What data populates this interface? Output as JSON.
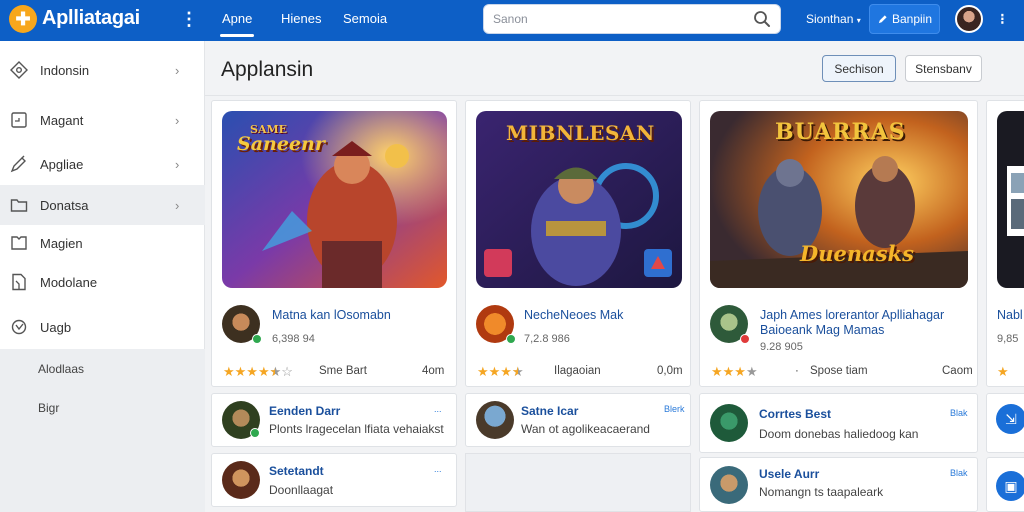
{
  "app": {
    "name": "Aplliatagai",
    "logo_glyph": "✚"
  },
  "topnav": {
    "tabs": [
      "Apne",
      "Hienes",
      "Semoia"
    ],
    "active_index": 0
  },
  "search": {
    "placeholder": "Sanon"
  },
  "toolbar": {
    "dropdown_label": "Sionthan",
    "button_label": "Banpiin"
  },
  "sidebar": {
    "items": [
      {
        "label": "Indonsin",
        "icon": "compass-icon",
        "chevron": true
      },
      {
        "label": "Magant",
        "icon": "file-icon",
        "chevron": true
      },
      {
        "label": "Apgliae",
        "icon": "tag-icon",
        "chevron": true
      },
      {
        "label": "Donatsa",
        "icon": "folder-icon",
        "chevron": true
      },
      {
        "label": "Magien",
        "icon": "bookmark-icon",
        "chevron": false
      },
      {
        "label": "Modolane",
        "icon": "document-icon",
        "chevron": false
      },
      {
        "label": "Uagb",
        "icon": "gear-icon",
        "chevron": false
      }
    ],
    "subitems": [
      "Alodlaas",
      "Bigr"
    ]
  },
  "page": {
    "title": "Applansin",
    "primary_button": "Sechison",
    "secondary_button": "Stensbanv"
  },
  "featured": [
    {
      "hero_title": "Saneenr",
      "hero_subtitle": "SAME",
      "name": "Matna kan lOsomabn",
      "size": "6,398 94",
      "rating": 4.5,
      "rating_label": "Sme Bart",
      "rating_value": "4om"
    },
    {
      "hero_title": "MIBNLESAN",
      "name": "NecheNeoes Mak",
      "size": "7,2.8 986",
      "rating": 3.5,
      "rating_label": "Ilagaoian",
      "rating_value": "0,0m"
    },
    {
      "hero_title": "BUARRAS",
      "hero_bottom": "Duenasks",
      "name": "Japh Ames lorerantor Aplliahagar Baioeank Mag Mamas",
      "size": "9.28 905",
      "rating": 4,
      "rating_label": "Spose tiam",
      "rating_value": "Caom"
    },
    {
      "name": "Nabl",
      "size": "9,85",
      "rating": 1
    }
  ],
  "list_items": [
    {
      "name": "Eenden Darr",
      "desc": "Plonts lragecelan lfiata vehaiakst",
      "meta": "..."
    },
    {
      "name": "Setetandt",
      "desc": "Doonllaagat",
      "meta": "..."
    },
    {
      "name": "Satne Icar",
      "desc": "Wan ot agolikeacaerand",
      "meta": "Blerk"
    },
    {
      "name": "Corrtes Best",
      "desc": "Doom donebas haliedoog kan",
      "meta": "Blak"
    },
    {
      "name": "Usele Aurr",
      "desc": "Nomangn ts taapaleark",
      "meta": "Blak"
    }
  ],
  "colors": {
    "brand_blue": "#0d5fc6",
    "star": "#f5a623",
    "link": "#1a4f9c"
  }
}
